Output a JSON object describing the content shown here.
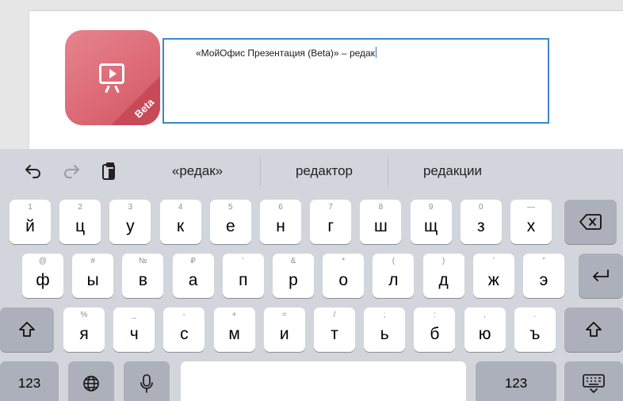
{
  "document": {
    "text": "«МойОфис Презентация (Beta)» – редак",
    "icon_badge": "Beta",
    "accent_color": "#3b87c8",
    "icon_color": "#dd6b77"
  },
  "keyboard": {
    "toolbar": {
      "undo_icon": "undo-icon",
      "redo_icon": "redo-icon",
      "paste_icon": "clipboard-icon",
      "suggestions": [
        "«редак»",
        "редактор",
        "редакции"
      ]
    },
    "rows": [
      [
        {
          "sub": "1",
          "main": "й"
        },
        {
          "sub": "2",
          "main": "ц"
        },
        {
          "sub": "3",
          "main": "у"
        },
        {
          "sub": "4",
          "main": "к"
        },
        {
          "sub": "5",
          "main": "е"
        },
        {
          "sub": "6",
          "main": "н"
        },
        {
          "sub": "7",
          "main": "г"
        },
        {
          "sub": "8",
          "main": "ш"
        },
        {
          "sub": "9",
          "main": "щ"
        },
        {
          "sub": "0",
          "main": "з"
        },
        {
          "sub": "—",
          "main": "х"
        }
      ],
      [
        {
          "sub": "@",
          "main": "ф"
        },
        {
          "sub": "#",
          "main": "ы"
        },
        {
          "sub": "№",
          "main": "в"
        },
        {
          "sub": "₽",
          "main": "а"
        },
        {
          "sub": "’",
          "main": "п"
        },
        {
          "sub": "&",
          "main": "р"
        },
        {
          "sub": "*",
          "main": "о"
        },
        {
          "sub": "(",
          "main": "л"
        },
        {
          "sub": ")",
          "main": "д"
        },
        {
          "sub": "’",
          "main": "ж"
        },
        {
          "sub": "”",
          "main": "э"
        }
      ],
      [
        {
          "sub": "%",
          "main": "я"
        },
        {
          "sub": "_",
          "main": "ч"
        },
        {
          "sub": "-",
          "main": "с"
        },
        {
          "sub": "+",
          "main": "м"
        },
        {
          "sub": "=",
          "main": "и"
        },
        {
          "sub": "/",
          "main": "т"
        },
        {
          "sub": ";",
          "main": "ь"
        },
        {
          "sub": ":",
          "main": "б"
        },
        {
          "sub": ",",
          "main": "ю"
        },
        {
          "sub": ".",
          "main": "ъ"
        }
      ]
    ],
    "bottom": {
      "numbers_left": "123",
      "numbers_right": "123",
      "globe_icon": "globe-icon",
      "mic_icon": "microphone-icon",
      "dismiss_icon": "keyboard-dismiss-icon"
    },
    "special_icons": {
      "delete": "backspace-icon",
      "return": "return-icon",
      "shift": "shift-icon"
    }
  }
}
